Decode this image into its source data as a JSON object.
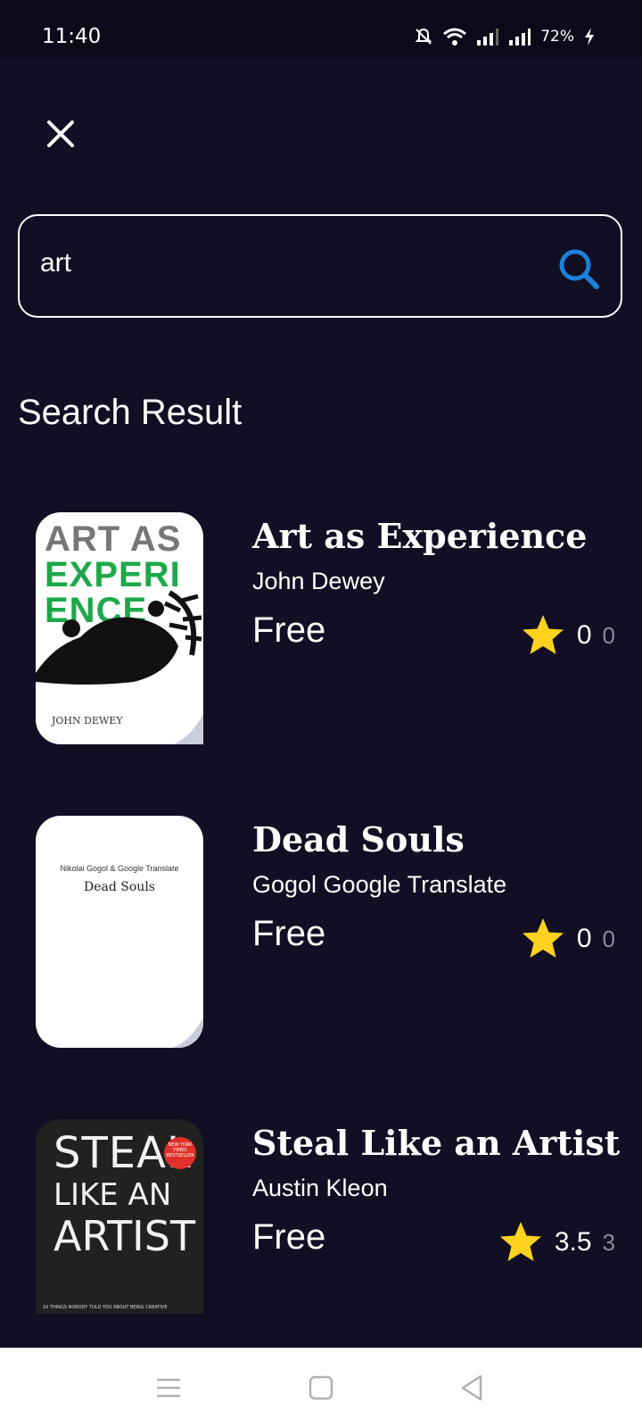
{
  "status_bar": {
    "time": "11:40",
    "battery": "72%"
  },
  "search": {
    "query": "art"
  },
  "section_title": "Search Result",
  "results": [
    {
      "title": "Art as Experience",
      "author": "John Dewey",
      "price": "Free",
      "rating": "0",
      "rating_count": "0",
      "cover": {
        "line1": "ART AS",
        "line2": "EXPERI",
        "line3": "ENCE",
        "author": "JOHN DEWEY"
      }
    },
    {
      "title": "Dead Souls",
      "author": "Gogol Google Translate",
      "price": "Free",
      "rating": "0",
      "rating_count": "0",
      "cover": {
        "author": "Nikolai Gogol & Google Translate",
        "title": "Dead Souls"
      }
    },
    {
      "title": "Steal Like an Artist",
      "author": "Austin Kleon",
      "price": "Free",
      "rating": "3.5",
      "rating_count": "3",
      "cover": {
        "line1": "STEAL",
        "line2": "LIKE AN",
        "line3": "ARTIST",
        "badge": "NEW YORK TIMES BESTSELLER",
        "subtitle": "10 THINGS NOBODY TOLD YOU ABOUT BEING CREATIVE"
      }
    }
  ],
  "colors": {
    "background": "#120e23",
    "accent": "#1e7fd9",
    "star": "#ffd21f",
    "cover_green": "#1fa84a"
  },
  "icons": [
    "close-icon",
    "search-icon",
    "star-icon",
    "menu-icon",
    "home-icon",
    "back-icon"
  ]
}
